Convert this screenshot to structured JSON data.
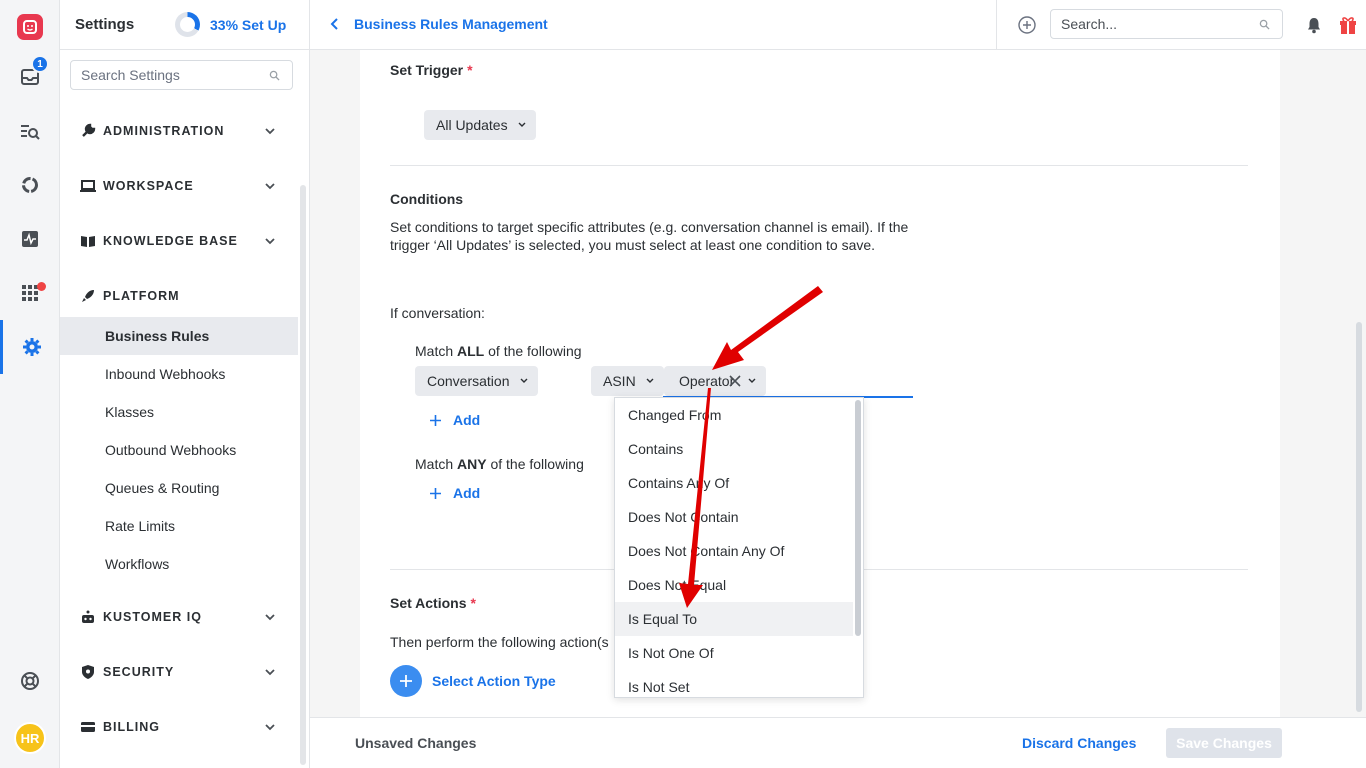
{
  "rail": {
    "inbox_badge": "1",
    "avatar_initials": "HR"
  },
  "sidebar": {
    "title": "Settings",
    "setup_progress": "33% Set Up",
    "setup_fraction": 0.33,
    "search_placeholder": "Search Settings",
    "sections": {
      "administration": "ADMINISTRATION",
      "workspace": "WORKSPACE",
      "knowledge_base": "KNOWLEDGE BASE",
      "platform": "PLATFORM",
      "kustomer_iq": "KUSTOMER IQ",
      "security": "SECURITY",
      "billing": "BILLING"
    },
    "platform_items": [
      "Business Rules",
      "Inbound Webhooks",
      "Klasses",
      "Outbound Webhooks",
      "Queues & Routing",
      "Rate Limits",
      "Workflows"
    ]
  },
  "topbar": {
    "breadcrumb": "Business Rules Management",
    "search_placeholder": "Search..."
  },
  "main": {
    "trigger_heading": "Set Trigger",
    "required_mark": "*",
    "trigger_value": "All Updates",
    "conditions_heading": "Conditions",
    "conditions_desc_1": "Set conditions to target specific attributes (e.g. conversation channel is email). If the",
    "conditions_desc_2": "trigger ‘All Updates’ is selected, you must select at least one condition to save.",
    "if_conversation": "If conversation:",
    "match_all_pre": "Match ",
    "match_all_bold": "ALL",
    "match_all_post": " of the following",
    "condition": {
      "object": "Conversation",
      "attribute": "ASIN",
      "operator": "Operator"
    },
    "add_label": "Add",
    "match_any_pre": "Match ",
    "match_any_bold": "ANY",
    "match_any_post": " of the following",
    "actions_heading": "Set Actions",
    "actions_desc": "Then perform the following action(s",
    "select_action": "Select Action Type"
  },
  "operator_options": [
    "Changed From",
    "Contains",
    "Contains Any Of",
    "Does Not Contain",
    "Does Not Contain Any Of",
    "Does Not Equal",
    "Is Equal To",
    "Is Not One Of",
    "Is Not Set"
  ],
  "highlighted_option": "Is Equal To",
  "footer": {
    "status": "Unsaved Changes",
    "discard": "Discard Changes",
    "save": "Save Changes"
  },
  "colors": {
    "accent": "#1a73e8",
    "brand": "#e8384f",
    "annotation_arrow": "#e00000"
  }
}
